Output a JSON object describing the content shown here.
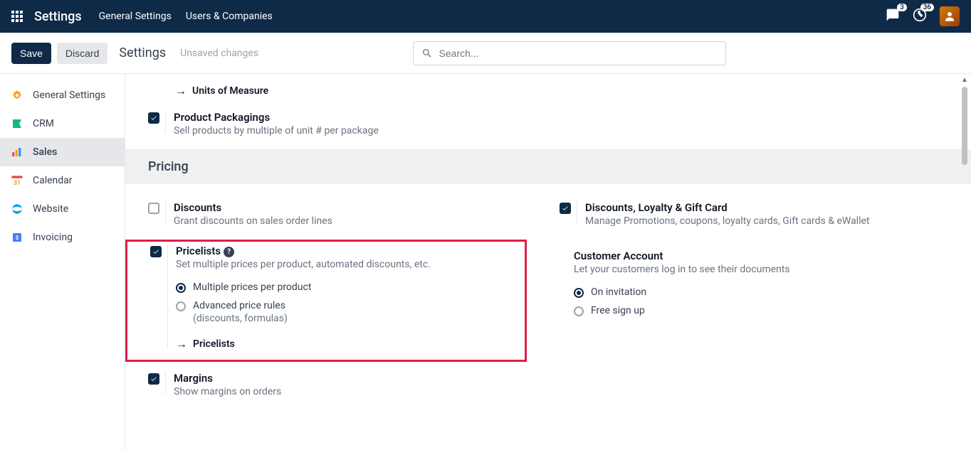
{
  "topbar": {
    "app_title": "Settings",
    "nav": {
      "general": "General Settings",
      "users": "Users & Companies"
    },
    "chat_badge": "3",
    "activity_badge": "36"
  },
  "toolbar": {
    "save": "Save",
    "discard": "Discard",
    "breadcrumb": "Settings",
    "unsaved": "Unsaved changes",
    "search_placeholder": "Search..."
  },
  "sidebar": {
    "general": "General Settings",
    "crm": "CRM",
    "sales": "Sales",
    "calendar": "Calendar",
    "website": "Website",
    "invoicing": "Invoicing"
  },
  "content": {
    "uom_link": "Units of Measure",
    "packagings": {
      "title": "Product Packagings",
      "desc": "Sell products by multiple of unit # per package"
    },
    "pricing_header": "Pricing",
    "discounts": {
      "title": "Discounts",
      "desc": "Grant discounts on sales order lines"
    },
    "loyalty": {
      "title": "Discounts, Loyalty & Gift Card",
      "desc": "Manage Promotions, coupons, loyalty cards, Gift cards & eWallet"
    },
    "pricelists": {
      "title": "Pricelists",
      "desc": "Set multiple prices per product, automated discounts, etc.",
      "radio_multi": "Multiple prices per product",
      "radio_adv": "Advanced price rules",
      "radio_adv_sub": "(discounts, formulas)",
      "link": "Pricelists"
    },
    "customer_account": {
      "title": "Customer Account",
      "desc": "Let your customers log in to see their documents",
      "radio_invitation": "On invitation",
      "radio_free": "Free sign up"
    },
    "margins": {
      "title": "Margins",
      "desc": "Show margins on orders"
    }
  }
}
